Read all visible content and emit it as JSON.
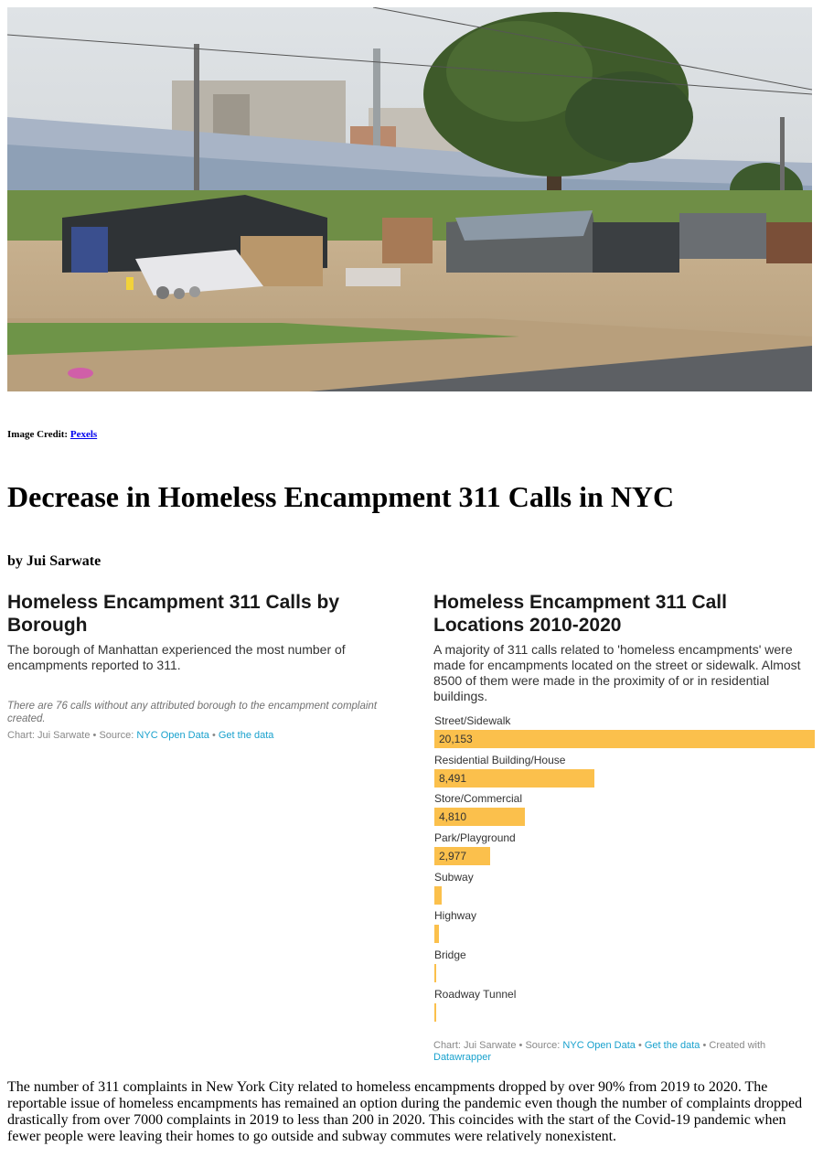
{
  "hero_image": {
    "alt": "Homeless encampment beside a road with solar panels and trees"
  },
  "credit": {
    "label": "Image Credit: ",
    "link_text": "Pexels"
  },
  "headline": "Decrease in Homeless Encampment 311 Calls in NYC",
  "byline": "by Jui Sarwate",
  "borough_chart": {
    "title": "Homeless Encampment 311 Calls by Borough",
    "description": "The borough of Manhattan experienced the most number of encampments reported to 311.",
    "note": "There are 76 calls without any attributed borough to the encampment complaint created.",
    "footer": {
      "prefix": "Chart: Jui Sarwate • Source: ",
      "source_link": "NYC Open Data",
      "sep": " • ",
      "data_link": "Get the data"
    }
  },
  "locations_chart": {
    "title": "Homeless Encampment 311 Call Locations 2010-2020",
    "description": "A majority of 311 calls related to 'homeless encampments' were made for encampments located on the street or sidewalk. Almost 8500 of them were made in the proximity of or in residential buildings.",
    "footer": {
      "prefix": "Chart: Jui Sarwate • Source: ",
      "source_link": "NYC Open Data",
      "sep": " • ",
      "data_link": "Get the data",
      "sep2": " • Created with ",
      "tool_link": "Datawrapper"
    }
  },
  "chart_data": {
    "type": "bar",
    "orientation": "horizontal",
    "title": "Homeless Encampment 311 Call Locations 2010-2020",
    "categories": [
      "Street/Sidewalk",
      "Residential Building/House",
      "Store/Commercial",
      "Park/Playground",
      "Subway",
      "Highway",
      "Bridge",
      "Roadway Tunnel"
    ],
    "values": [
      20153,
      8491,
      4810,
      2977,
      400,
      220,
      90,
      40
    ],
    "labels": [
      "20,153",
      "8,491",
      "4,810",
      "2,977",
      "",
      "",
      "",
      ""
    ],
    "bar_color": "#fbc04c",
    "xlim": [
      0,
      20153
    ]
  },
  "article": {
    "body": "The number of 311 complaints in New York City related to homeless encampments dropped by over 90% from 2019 to 2020. The reportable issue of homeless encampments has remained an option during the pandemic even though the number of complaints dropped drastically from over 7000 complaints in 2019 to less than 200 in 2020. This coincides with the start of the Covid-19 pandemic when fewer people were leaving their homes to go outside and subway commutes were relatively nonexistent."
  }
}
